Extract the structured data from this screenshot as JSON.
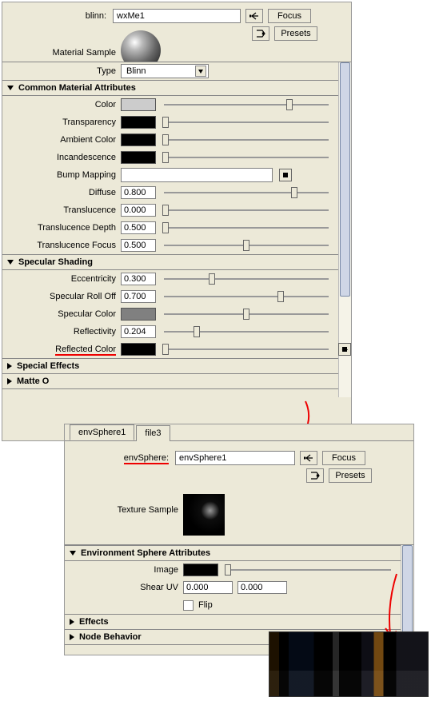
{
  "panel1": {
    "name_label": "blinn:",
    "name_value": "wxMe1",
    "focus": "Focus",
    "presets": "Presets",
    "material_sample": "Material Sample",
    "type_label": "Type",
    "type_value": "Blinn",
    "sections": {
      "common": "Common Material Attributes",
      "specular": "Specular Shading",
      "specialfx": "Special Effects",
      "matte": "Matte O"
    },
    "attrs": {
      "color": "Color",
      "transparency": "Transparency",
      "ambient_color": "Ambient Color",
      "incandescence": "Incandescence",
      "bump_mapping": "Bump Mapping",
      "diffuse": "Diffuse",
      "diffuse_v": "0.800",
      "translucence": "Translucence",
      "translucence_v": "0.000",
      "translucence_depth": "Translucence Depth",
      "translucence_depth_v": "0.500",
      "translucence_focus": "Translucence Focus",
      "translucence_focus_v": "0.500",
      "eccentricity": "Eccentricity",
      "eccentricity_v": "0.300",
      "specular_rolloff": "Specular Roll Off",
      "specular_rolloff_v": "0.700",
      "specular_color": "Specular Color",
      "reflectivity": "Reflectivity",
      "reflectivity_v": "0.204",
      "reflected_color": "Reflected Color"
    },
    "swatches": {
      "color": "#cccccc",
      "black": "#000000",
      "spec_color": "#808080"
    }
  },
  "panel2": {
    "tab1": "envSphere1",
    "tab2": "file3",
    "name_label": "envSphere:",
    "name_value": "envSphere1",
    "focus": "Focus",
    "presets": "Presets",
    "texture_sample": "Texture Sample",
    "sections": {
      "env": "Environment Sphere Attributes",
      "effects": "Effects",
      "node": "Node Behavior"
    },
    "attrs": {
      "image": "Image",
      "shear_uv": "Shear UV",
      "shear_u": "0.000",
      "shear_v": "0.000",
      "flip": "Flip"
    }
  }
}
